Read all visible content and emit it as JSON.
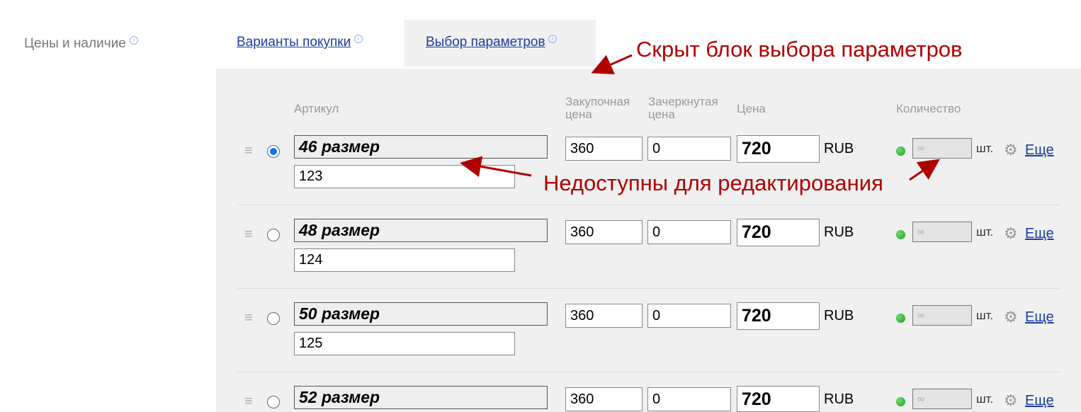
{
  "section": {
    "label": "Цены и наличие",
    "info": "i"
  },
  "tabs": [
    {
      "label": "Варианты покупки",
      "info": "i",
      "active": false
    },
    {
      "label": "Выбор параметров",
      "info": "i",
      "active": true
    }
  ],
  "table": {
    "headers": {
      "sku": "Артикул",
      "purchase_line1": "Закупочная",
      "purchase_line2": "цена",
      "crossed_line1": "Зачеркнутая",
      "crossed_line2": "цена",
      "price": "Цена",
      "quantity": "Количество"
    },
    "rows": [
      {
        "name": "46 размер",
        "sku": "123",
        "purchase": "360",
        "crossed": "0",
        "price": "720",
        "currency": "RUB",
        "qty_placeholder": "∞",
        "unit": "шт.",
        "more": "Еще",
        "selected": true
      },
      {
        "name": "48 размер",
        "sku": "124",
        "purchase": "360",
        "crossed": "0",
        "price": "720",
        "currency": "RUB",
        "qty_placeholder": "∞",
        "unit": "шт.",
        "more": "Еще",
        "selected": false
      },
      {
        "name": "50 размер",
        "sku": "125",
        "purchase": "360",
        "crossed": "0",
        "price": "720",
        "currency": "RUB",
        "qty_placeholder": "∞",
        "unit": "шт.",
        "more": "Еще",
        "selected": false
      },
      {
        "name": "52 размер",
        "sku": "",
        "purchase": "360",
        "crossed": "0",
        "price": "720",
        "currency": "RUB",
        "qty_placeholder": "∞",
        "unit": "шт.",
        "more": "Еще",
        "selected": false
      }
    ]
  },
  "annotations": {
    "hidden_block": "Скрыт блок выбора параметров",
    "not_editable": "Недоступны для редактирования"
  },
  "colors": {
    "link": "#1a3e9e",
    "annotation": "#b00000",
    "panel": "#f0f0f0",
    "status_dot": "#2bb52b"
  }
}
